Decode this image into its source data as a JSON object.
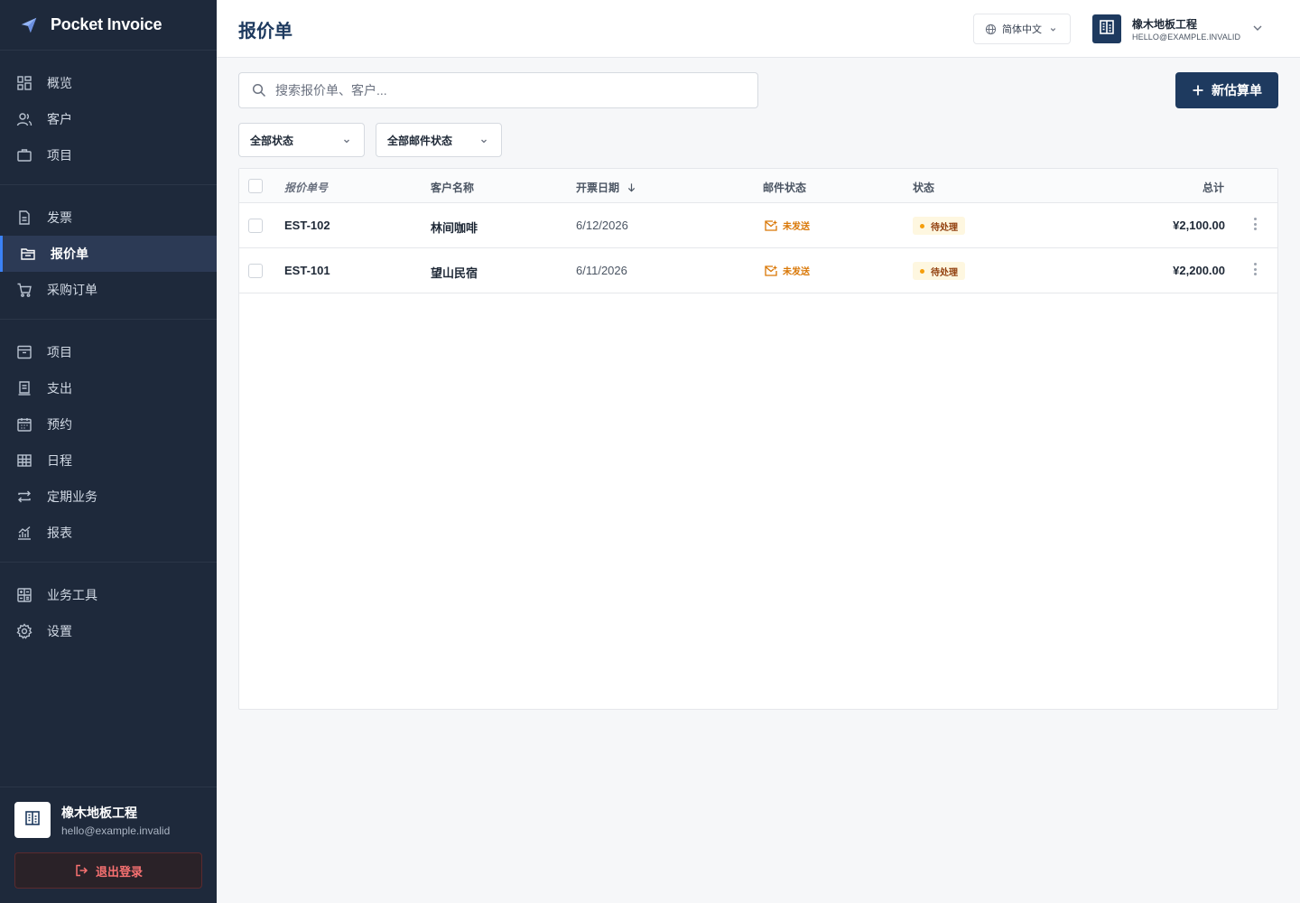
{
  "app": {
    "name": "Pocket Invoice"
  },
  "sidebar": {
    "groups": [
      [
        {
          "label": "概览",
          "icon": "grid-icon"
        },
        {
          "label": "客户",
          "icon": "users-icon"
        },
        {
          "label": "项目",
          "icon": "briefcase-icon"
        }
      ],
      [
        {
          "label": "发票",
          "icon": "document-icon"
        },
        {
          "label": "报价单",
          "icon": "folder-icon",
          "active": true
        },
        {
          "label": "采购订单",
          "icon": "cart-icon"
        }
      ],
      [
        {
          "label": "项目",
          "icon": "archive-icon"
        },
        {
          "label": "支出",
          "icon": "receipt-icon"
        },
        {
          "label": "预约",
          "icon": "calendar-icon"
        },
        {
          "label": "日程",
          "icon": "table-icon"
        },
        {
          "label": "定期业务",
          "icon": "repeat-icon"
        },
        {
          "label": "报表",
          "icon": "chart-icon"
        }
      ],
      [
        {
          "label": "业务工具",
          "icon": "calculator-icon"
        },
        {
          "label": "设置",
          "icon": "gear-icon"
        }
      ]
    ],
    "company": {
      "name": "橡木地板工程",
      "email": "hello@example.invalid"
    },
    "logout_label": "退出登录"
  },
  "header": {
    "title": "报价单",
    "language": "简体中文",
    "account": {
      "name": "橡木地板工程",
      "email": "HELLO@EXAMPLE.INVALID"
    }
  },
  "toolbar": {
    "search_placeholder": "搜索报价单、客户...",
    "new_button": "新估算单",
    "filter_status": "全部状态",
    "filter_mail": "全部邮件状态"
  },
  "table": {
    "columns": {
      "number": "报价单号",
      "client": "客户名称",
      "date": "开票日期",
      "mail": "邮件状态",
      "status": "状态",
      "total": "总计"
    },
    "rows": [
      {
        "number": "EST-102",
        "client": "林间咖啡",
        "date": "6/12/2026",
        "mail": "未发送",
        "status": "待处理",
        "total": "¥2,100.00"
      },
      {
        "number": "EST-101",
        "client": "望山民宿",
        "date": "6/11/2026",
        "mail": "未发送",
        "status": "待处理",
        "total": "¥2,200.00"
      }
    ]
  },
  "colors": {
    "sidebar": "#1e293b",
    "primary": "#1e3a5f",
    "accent": "#3b82f6",
    "warning": "#d97706",
    "danger": "#f87171"
  }
}
